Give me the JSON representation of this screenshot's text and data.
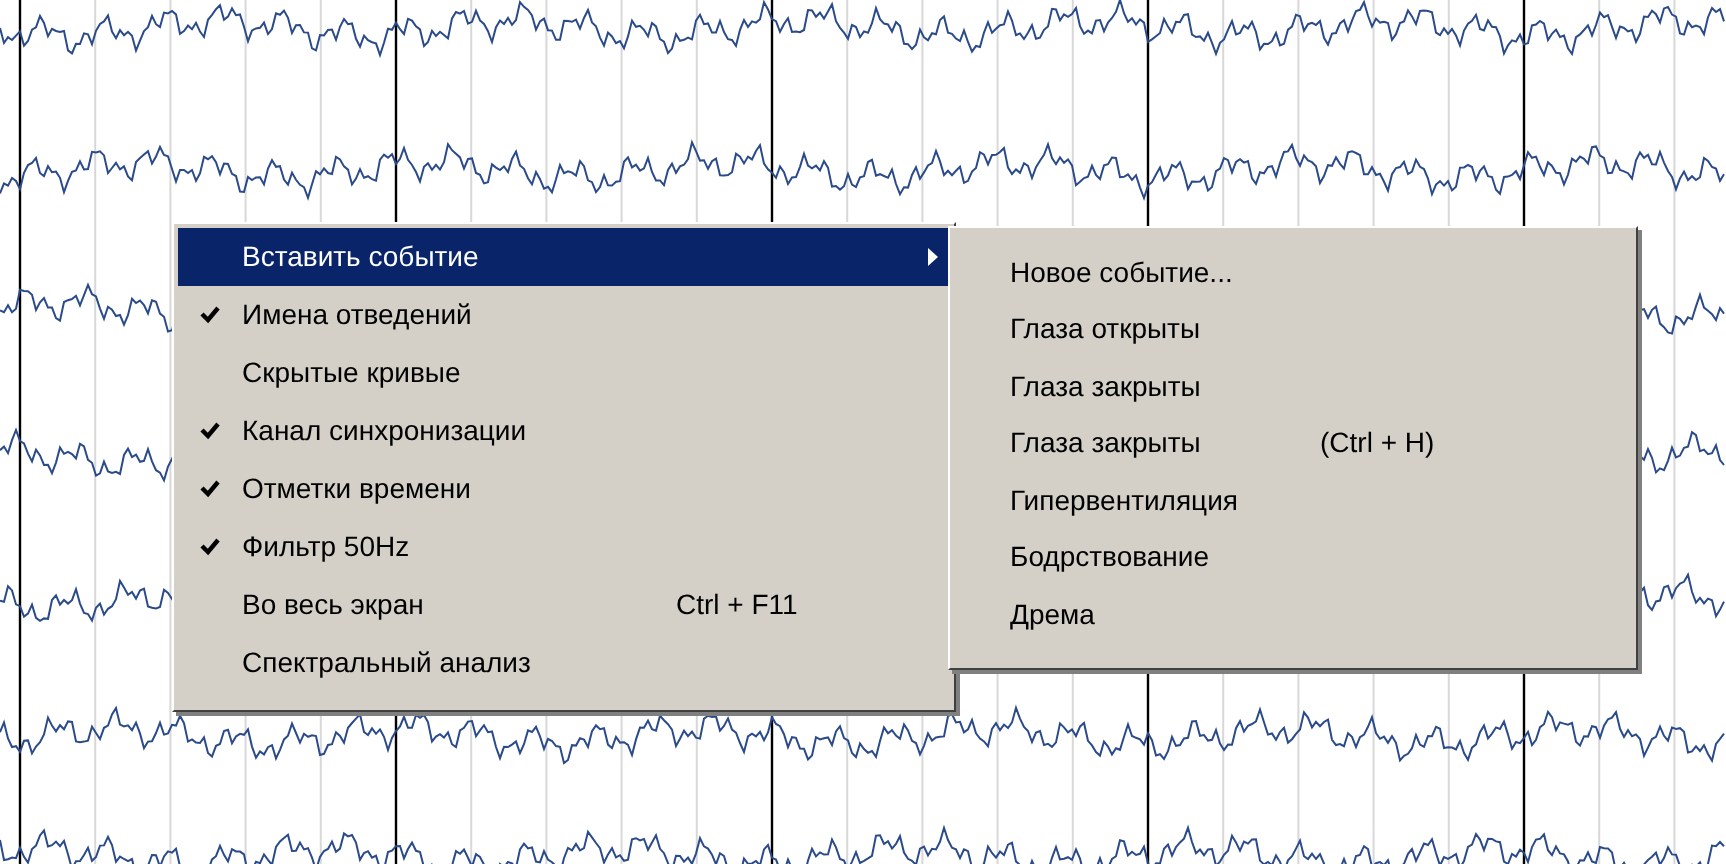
{
  "context_menu": {
    "items": [
      {
        "kind": "submenu",
        "label": "Вставить событие",
        "checked": false,
        "selected": true
      },
      {
        "kind": "item",
        "label": "Имена отведений",
        "checked": true,
        "selected": false
      },
      {
        "kind": "item",
        "label": "Скрытые кривые",
        "checked": false,
        "selected": false
      },
      {
        "kind": "item",
        "label": "Канал синхронизации",
        "checked": true,
        "selected": false
      },
      {
        "kind": "item",
        "label": "Отметки времени",
        "checked": true,
        "selected": false
      },
      {
        "kind": "item",
        "label": "Фильтр 50Hz",
        "checked": true,
        "selected": false
      },
      {
        "kind": "item",
        "label": "Во весь экран",
        "shortcut": "Ctrl + F11",
        "checked": false,
        "selected": false
      },
      {
        "kind": "item",
        "label": "Спектральный анализ",
        "checked": false,
        "selected": false
      }
    ]
  },
  "submenu": {
    "items": [
      {
        "label": "Новое событие..."
      },
      {
        "label": "Глаза открыты"
      },
      {
        "label": "Глаза закрыты"
      },
      {
        "label": "Глаза закрыты",
        "shortcut": "(Ctrl + H)"
      },
      {
        "label": "Гипервентиляция"
      },
      {
        "label": "Бодрствование"
      },
      {
        "label": "Дрема"
      }
    ]
  }
}
